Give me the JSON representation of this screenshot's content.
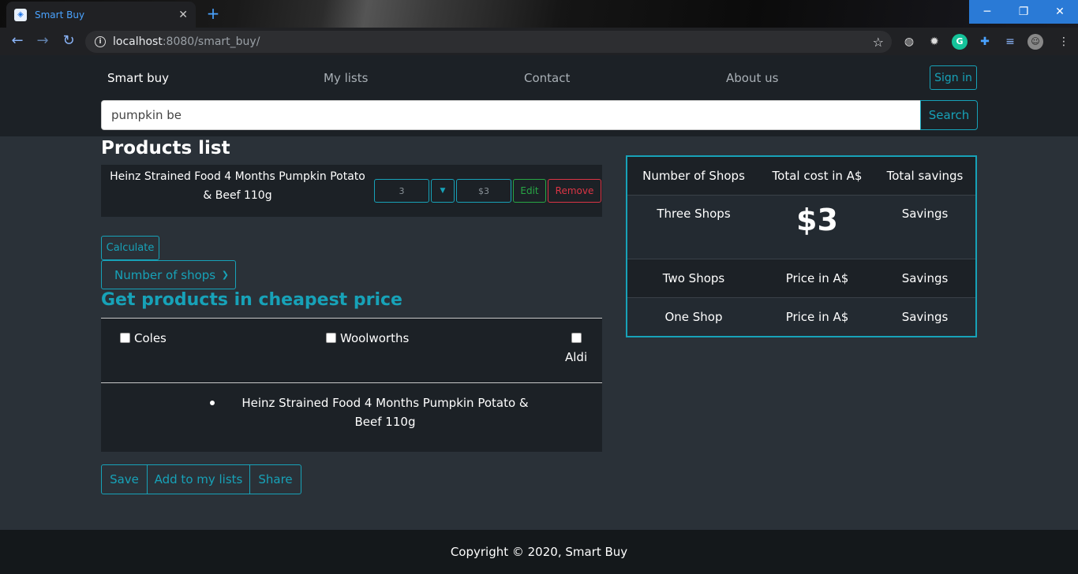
{
  "browser": {
    "tab_title": "Smart Buy",
    "url_host": "localhost",
    "url_path": ":8080/smart_buy/"
  },
  "nav": {
    "brand": "Smart buy",
    "links": [
      "My lists",
      "Contact",
      "About us"
    ],
    "signin": "Sign in"
  },
  "search": {
    "value": "pumpkin be",
    "button": "Search"
  },
  "products": {
    "title": "Products list",
    "items": [
      {
        "name": "Heinz Strained Food 4 Months Pumpkin Potato & Beef 110g",
        "quantity": "3",
        "price": "$3",
        "edit": "Edit",
        "remove": "Remove"
      }
    ]
  },
  "controls": {
    "calculate": "Calculate",
    "shops_select": "Number of shops"
  },
  "cheapest": {
    "title": "Get products in cheapest price",
    "shops": [
      "Coles",
      "Woolworths",
      "Aldi"
    ],
    "items": [
      "Heinz Strained Food 4 Months Pumpkin Potato & Beef 110g"
    ]
  },
  "actions": [
    "Save",
    "Add to my lists",
    "Share"
  ],
  "summary": {
    "headers": [
      "Number of Shops",
      "Total cost in A$",
      "Total savings"
    ],
    "rows": [
      [
        "Three Shops",
        "$3",
        "Savings"
      ],
      [
        "Two Shops",
        "Price in A$",
        "Savings"
      ],
      [
        "One Shop",
        "Price in A$",
        "Savings"
      ]
    ]
  },
  "footer": "Copyright © 2020, Smart Buy",
  "colors": {
    "accent": "#17a2b8",
    "success": "#28a745",
    "danger": "#dc3545"
  }
}
